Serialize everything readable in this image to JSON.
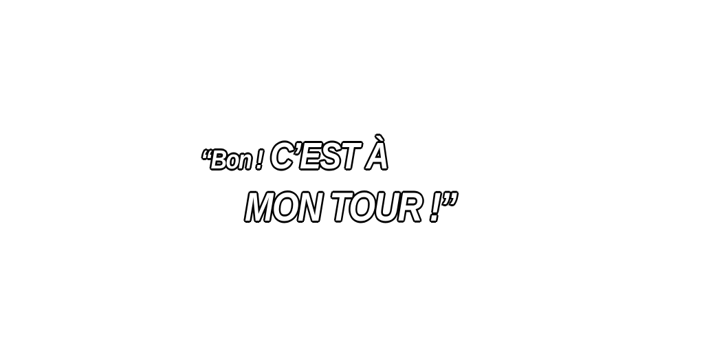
{
  "caption": {
    "line1_small": "“Bon !",
    "line1_big": "C’EST À",
    "line2": "MON TOUR !”"
  },
  "colors": {
    "background": "#ffffff",
    "text_fill": "#ffffff",
    "text_outline": "#000000"
  }
}
